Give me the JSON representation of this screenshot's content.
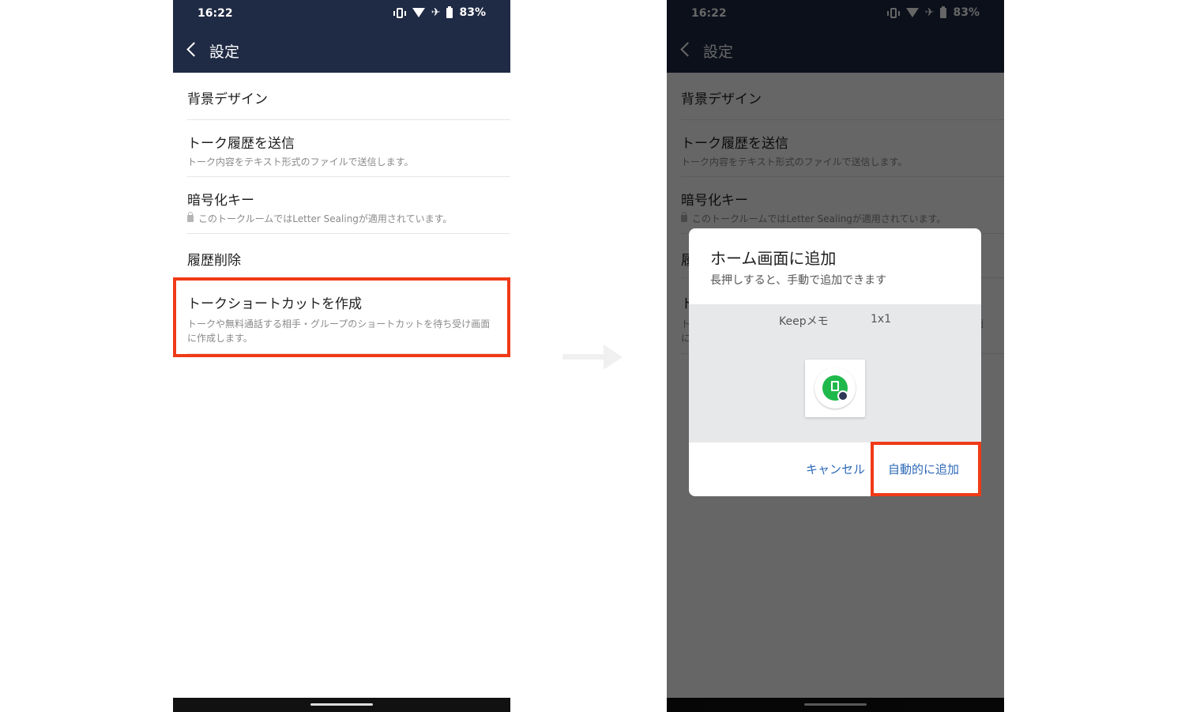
{
  "statusbar": {
    "time": "16:22",
    "battery": "83%"
  },
  "appbar": {
    "title": "設定"
  },
  "settings": {
    "background": {
      "label": "背景デザイン"
    },
    "export": {
      "label": "トーク履歴を送信",
      "desc": "トーク内容をテキスト形式のファイルで送信します。"
    },
    "key": {
      "label": "暗号化キー",
      "desc": "このトークルームではLetter Sealingが適用されています。"
    },
    "clear": {
      "label": "履歴削除"
    },
    "shortcut": {
      "label": "トークショートカットを作成",
      "desc": "トークや無料通話する相手・グループのショートカットを待ち受け画面に作成します。"
    }
  },
  "dialog": {
    "title": "ホーム画面に追加",
    "subtitle": "長押しすると、手動で追加できます",
    "widget_name": "Keepメモ",
    "widget_size": "1x1",
    "cancel": "キャンセル",
    "add": "自動的に追加"
  },
  "colors": {
    "appbar": "#1f2a44",
    "highlight": "#f03a17",
    "accent": "#2d6ab7",
    "keep_green": "#1fb84b"
  },
  "icons": [
    "back-icon",
    "vibrate-icon",
    "wifi-icon",
    "airplane-icon",
    "battery-icon",
    "lock-icon",
    "keep-memo-icon",
    "arrow-right-icon"
  ]
}
